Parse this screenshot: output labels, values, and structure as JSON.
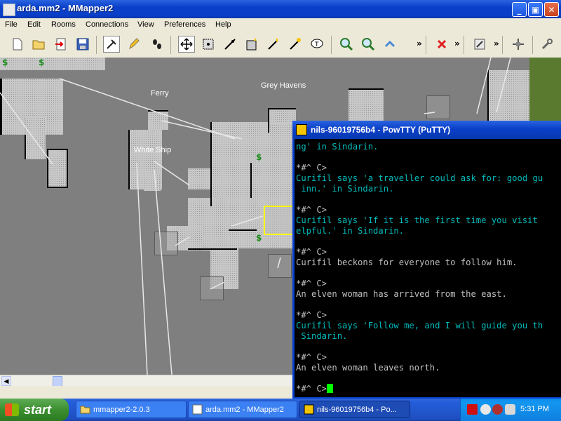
{
  "window": {
    "title": "arda.mm2 - MMapper2",
    "min_label": "_",
    "max_label": "▣",
    "close_label": "✕"
  },
  "menu": [
    "File",
    "Edit",
    "Rooms",
    "Connections",
    "View",
    "Preferences",
    "Help"
  ],
  "toolbar": {
    "buttons": [
      "new-file-icon",
      "open-file-icon",
      "merge-icon",
      "save-icon",
      "mouse-mode-icon",
      "pencil-icon",
      "footprints-icon",
      "move-icon",
      "select-room-icon",
      "select-connection-icon",
      "create-room-icon",
      "create-connection-icon",
      "info-mark-icon",
      "zoom-in-icon",
      "zoom-out-icon",
      "layer-up-icon",
      "delete-icon",
      "prefs-icon",
      "wrench-icon"
    ],
    "overflow": "»"
  },
  "map": {
    "labels": {
      "ferry": "Ferry",
      "grey_havens": "Grey Havens",
      "white_ship": "White Ship"
    }
  },
  "putty": {
    "title": "nils-96019756b4 - PowTTY (PuTTY)",
    "lines": [
      {
        "text": "ng' in Sindarin.",
        "color": "cyan"
      },
      {
        "text": "",
        "color": "white"
      },
      {
        "text": "*#^ C>",
        "color": "white"
      },
      {
        "text": "Curifil says 'a traveller could ask for: good gu",
        "color": "cyan"
      },
      {
        "text": " inn.' in Sindarin.",
        "color": "cyan"
      },
      {
        "text": "",
        "color": "white"
      },
      {
        "text": "*#^ C>",
        "color": "white"
      },
      {
        "text": "Curifil says 'If it is the first time you visit",
        "color": "cyan"
      },
      {
        "text": "elpful.' in Sindarin.",
        "color": "cyan"
      },
      {
        "text": "",
        "color": "white"
      },
      {
        "text": "*#^ C>",
        "color": "white"
      },
      {
        "text": "Curifil beckons for everyone to follow him.",
        "color": "white"
      },
      {
        "text": "",
        "color": "white"
      },
      {
        "text": "*#^ C>",
        "color": "white"
      },
      {
        "text": "An elven woman has arrived from the east.",
        "color": "white"
      },
      {
        "text": "",
        "color": "white"
      },
      {
        "text": "*#^ C>",
        "color": "white"
      },
      {
        "text": "Curifil says 'Follow me, and I will guide you th",
        "color": "cyan"
      },
      {
        "text": " Sindarin.",
        "color": "cyan"
      },
      {
        "text": "",
        "color": "white"
      },
      {
        "text": "*#^ C>",
        "color": "white"
      },
      {
        "text": "An elven woman leaves north.",
        "color": "white"
      },
      {
        "text": "",
        "color": "white"
      }
    ],
    "prompt": "*#^ C>"
  },
  "taskbar": {
    "start": "start",
    "tasks": [
      "mmapper2-2.0.3",
      "arda.mm2 - MMapper2",
      "nils-96019756b4 - Po..."
    ],
    "clock": "5:31 PM"
  },
  "colors": {
    "title_blue": "#0a3fc9",
    "term_cyan": "#00bbbb",
    "term_white": "#c0c0c0",
    "cursor_green": "#00ff00",
    "selection_yellow": "#ffff00"
  }
}
